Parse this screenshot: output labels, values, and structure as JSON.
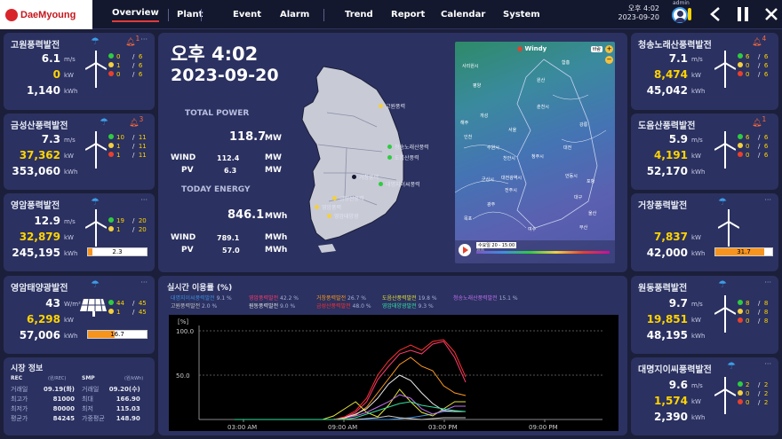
{
  "app": {
    "logo": "DaeMyoung",
    "user": "admin",
    "clock_time": "오후 4:02",
    "clock_date": "2023-09-20"
  },
  "nav": {
    "items": [
      "Overview",
      "Plant",
      "Event",
      "Alarm",
      "Trend",
      "Report",
      "Calendar",
      "System"
    ],
    "active": "Overview"
  },
  "icons": {
    "user": "user-icon",
    "back": "back-icon",
    "pause": "pause-icon",
    "close": "close-icon"
  },
  "colors": {
    "accent_yellow": "#ffd400",
    "accent_orange": "#ff9a1f",
    "green": "#2ecc40",
    "yellow": "#f4d03f",
    "red": "#e8412c",
    "panel": "#2b3160"
  },
  "sites_left": [
    {
      "name": "고원풍력발전",
      "wind": "6.1",
      "power": "0",
      "energy": "1,140",
      "alarm": "1",
      "counts": [
        {
          "a": "0",
          "b": "6"
        },
        {
          "a": "1",
          "b": "6"
        },
        {
          "a": "0",
          "b": "6"
        }
      ]
    },
    {
      "name": "금성산풍력발전",
      "wind": "7.3",
      "power": "37,362",
      "energy": "353,060",
      "alarm": "3",
      "counts": [
        {
          "a": "10",
          "b": "11"
        },
        {
          "a": "1",
          "b": "11"
        },
        {
          "a": "1",
          "b": "11"
        }
      ]
    },
    {
      "name": "영암풍력발전",
      "wind": "12.9",
      "power": "32,879",
      "energy": "245,195",
      "counts": [
        {
          "a": "19",
          "b": "20"
        },
        {
          "a": "1",
          "b": "20"
        }
      ],
      "bar": "2.3",
      "bar_pct": 0.07
    },
    {
      "name": "영암태양광발전",
      "wind": "43",
      "power": "6,298",
      "energy": "57,006",
      "counts": [
        {
          "a": "44",
          "b": "45"
        },
        {
          "a": "1",
          "b": "45"
        }
      ],
      "bar": "16.7",
      "bar_pct": 0.45
    }
  ],
  "sites_right": [
    {
      "name": "청송노래산풍력발전",
      "wind": "7.1",
      "power": "8,474",
      "energy": "45,042",
      "alarm": "4",
      "counts": [
        {
          "a": "6",
          "b": "6"
        },
        {
          "a": "0",
          "b": "6"
        },
        {
          "a": "0",
          "b": "6"
        }
      ]
    },
    {
      "name": "도음산풍력발전",
      "wind": "5.9",
      "power": "4,191",
      "energy": "52,170",
      "alarm": "1",
      "counts": [
        {
          "a": "6",
          "b": "6"
        },
        {
          "a": "0",
          "b": "6"
        },
        {
          "a": "0",
          "b": "6"
        }
      ]
    },
    {
      "name": "거창풍력발전",
      "wind": "",
      "power": "7,837",
      "energy": "42,000",
      "bar": "31.7",
      "bar_pct": 0.86
    },
    {
      "name": "원동풍력발전",
      "wind": "9.7",
      "power": "19,851",
      "energy": "48,195",
      "counts": [
        {
          "a": "8",
          "b": "8"
        },
        {
          "a": "0",
          "b": "8"
        },
        {
          "a": "0",
          "b": "8"
        }
      ]
    },
    {
      "name": "대명지이씨풍력발전",
      "wind": "9.6",
      "power": "1,574",
      "energy": "2,390",
      "counts": [
        {
          "a": "2",
          "b": "2"
        },
        {
          "a": "0",
          "b": "2"
        },
        {
          "a": "0",
          "b": "2"
        }
      ]
    }
  ],
  "units": {
    "ms": "m/s",
    "kw": "kW",
    "kwh": "kWh",
    "wm2": "W/m²",
    "mw": "MW",
    "mwh": "MWh"
  },
  "summary": {
    "time": "오후 4:02",
    "date": "2023-09-20",
    "total_power_label": "TOTAL POWER",
    "total_power": "118.7",
    "wind_label": "WIND",
    "wind_power": "112.4",
    "pv_label": "PV",
    "pv_power": "6.3",
    "today_energy_label": "TODAY ENERGY",
    "today_energy": "846.1",
    "wind_energy": "789.1",
    "pv_energy": "57.0"
  },
  "map_labels": [
    "고원풍력",
    "청송노래산풍력",
    "도음산풍력",
    "거창풍력",
    "대명지이씨풍력",
    "금성산풍력",
    "영암풍력",
    "영암태양광"
  ],
  "windy": {
    "brand": "Windy",
    "zoom_plus": "+",
    "zoom_minus": "−",
    "badge": "바람",
    "timebar": "수요일 20 - 15:00",
    "cities": [
      "사리원시",
      "평양",
      "원산",
      "함흥",
      "해주",
      "개성",
      "춘천시",
      "강릉",
      "서울",
      "인천",
      "수원시",
      "천안시",
      "청주시",
      "대전",
      "안동시",
      "대전광역시",
      "포항",
      "대구",
      "울산",
      "부산",
      "광주",
      "목포",
      "전주시",
      "군산시",
      "여수",
      "제주"
    ]
  },
  "market": {
    "title": "시장 정보",
    "h1": "REC",
    "h2": "SMP",
    "unit1": "(원/REC)",
    "unit2": "(원/kWh)",
    "rows": [
      [
        "거래일",
        "09.19(화)",
        "거래일",
        "09.20(수)"
      ],
      [
        "최고가",
        "81000",
        "최대",
        "166.90"
      ],
      [
        "최저가",
        "80000",
        "최저",
        "115.03"
      ],
      [
        "평균가",
        "84245",
        "가중평균",
        "148.90"
      ]
    ]
  },
  "chart_data": {
    "type": "line",
    "title": "실시간 이용률 (%)",
    "ylabel": "[%]",
    "ylim": [
      0,
      100
    ],
    "yticks": [
      "100.0",
      "50.0"
    ],
    "xticks": [
      "03:00 AM",
      "09:00 AM",
      "03:00 PM",
      "09:00 PM"
    ],
    "series": [
      {
        "name": "대명지이씨풍력발전",
        "value": "9.1 %",
        "color": "#3d8fe0",
        "values": [
          0,
          0,
          0,
          0,
          0,
          0,
          0,
          0,
          0,
          0,
          0,
          0,
          0,
          0,
          0,
          1,
          2,
          4,
          6,
          9,
          9,
          9
        ]
      },
      {
        "name": "영암풍력발전",
        "value": "42.2 %",
        "color": "#ff3a6e",
        "values": [
          0,
          0,
          0,
          0,
          0,
          0,
          0,
          0,
          0,
          0,
          2,
          8,
          20,
          45,
          60,
          74,
          78,
          74,
          85,
          88,
          70,
          42
        ]
      },
      {
        "name": "거창풍력발전",
        "value": "26.7 %",
        "color": "#ff9a1f",
        "values": [
          0,
          0,
          0,
          0,
          0,
          0,
          0,
          0,
          0,
          0,
          1,
          5,
          14,
          30,
          46,
          62,
          70,
          60,
          55,
          38,
          30,
          27
        ]
      },
      {
        "name": "도음산풍력발전",
        "value": "19.8 %",
        "color": "#e3e33a",
        "values": [
          0,
          0,
          0,
          0,
          0,
          0,
          0,
          0,
          0,
          4,
          12,
          20,
          8,
          3,
          16,
          34,
          20,
          8,
          4,
          12,
          20,
          20
        ]
      },
      {
        "name": "청송노래산풍력발전",
        "value": "15.1 %",
        "color": "#c070f0",
        "values": [
          0,
          0,
          0,
          0,
          0,
          0,
          0,
          0,
          0,
          0,
          2,
          4,
          8,
          14,
          20,
          28,
          24,
          12,
          6,
          10,
          15,
          15
        ]
      },
      {
        "name": "고원풍력발전",
        "value": "2.0 %",
        "color": "#c8c8c8",
        "values": [
          0,
          0,
          0,
          0,
          0,
          0,
          0,
          0,
          0,
          0,
          0,
          0,
          1,
          2,
          4,
          2,
          1,
          0,
          1,
          2,
          2,
          2
        ]
      },
      {
        "name": "원동풍력발전",
        "value": "9.0 %",
        "color": "#e8e8e8",
        "values": [
          0,
          0,
          0,
          0,
          0,
          0,
          0,
          0,
          0,
          0,
          2,
          6,
          12,
          24,
          40,
          50,
          44,
          30,
          18,
          10,
          9,
          9
        ]
      },
      {
        "name": "금성산풍력발전",
        "value": "48.0 %",
        "color": "#ff3030",
        "values": [
          0,
          0,
          0,
          0,
          0,
          0,
          0,
          0,
          0,
          0,
          3,
          10,
          24,
          50,
          66,
          78,
          84,
          78,
          88,
          90,
          76,
          48
        ]
      },
      {
        "name": "영암태양광발전",
        "value": "9.3 %",
        "color": "#35e0a0",
        "values": [
          0,
          0,
          0,
          0,
          0,
          0,
          0,
          0,
          0,
          0,
          0,
          2,
          6,
          10,
          14,
          18,
          20,
          16,
          14,
          12,
          10,
          9
        ]
      }
    ]
  }
}
